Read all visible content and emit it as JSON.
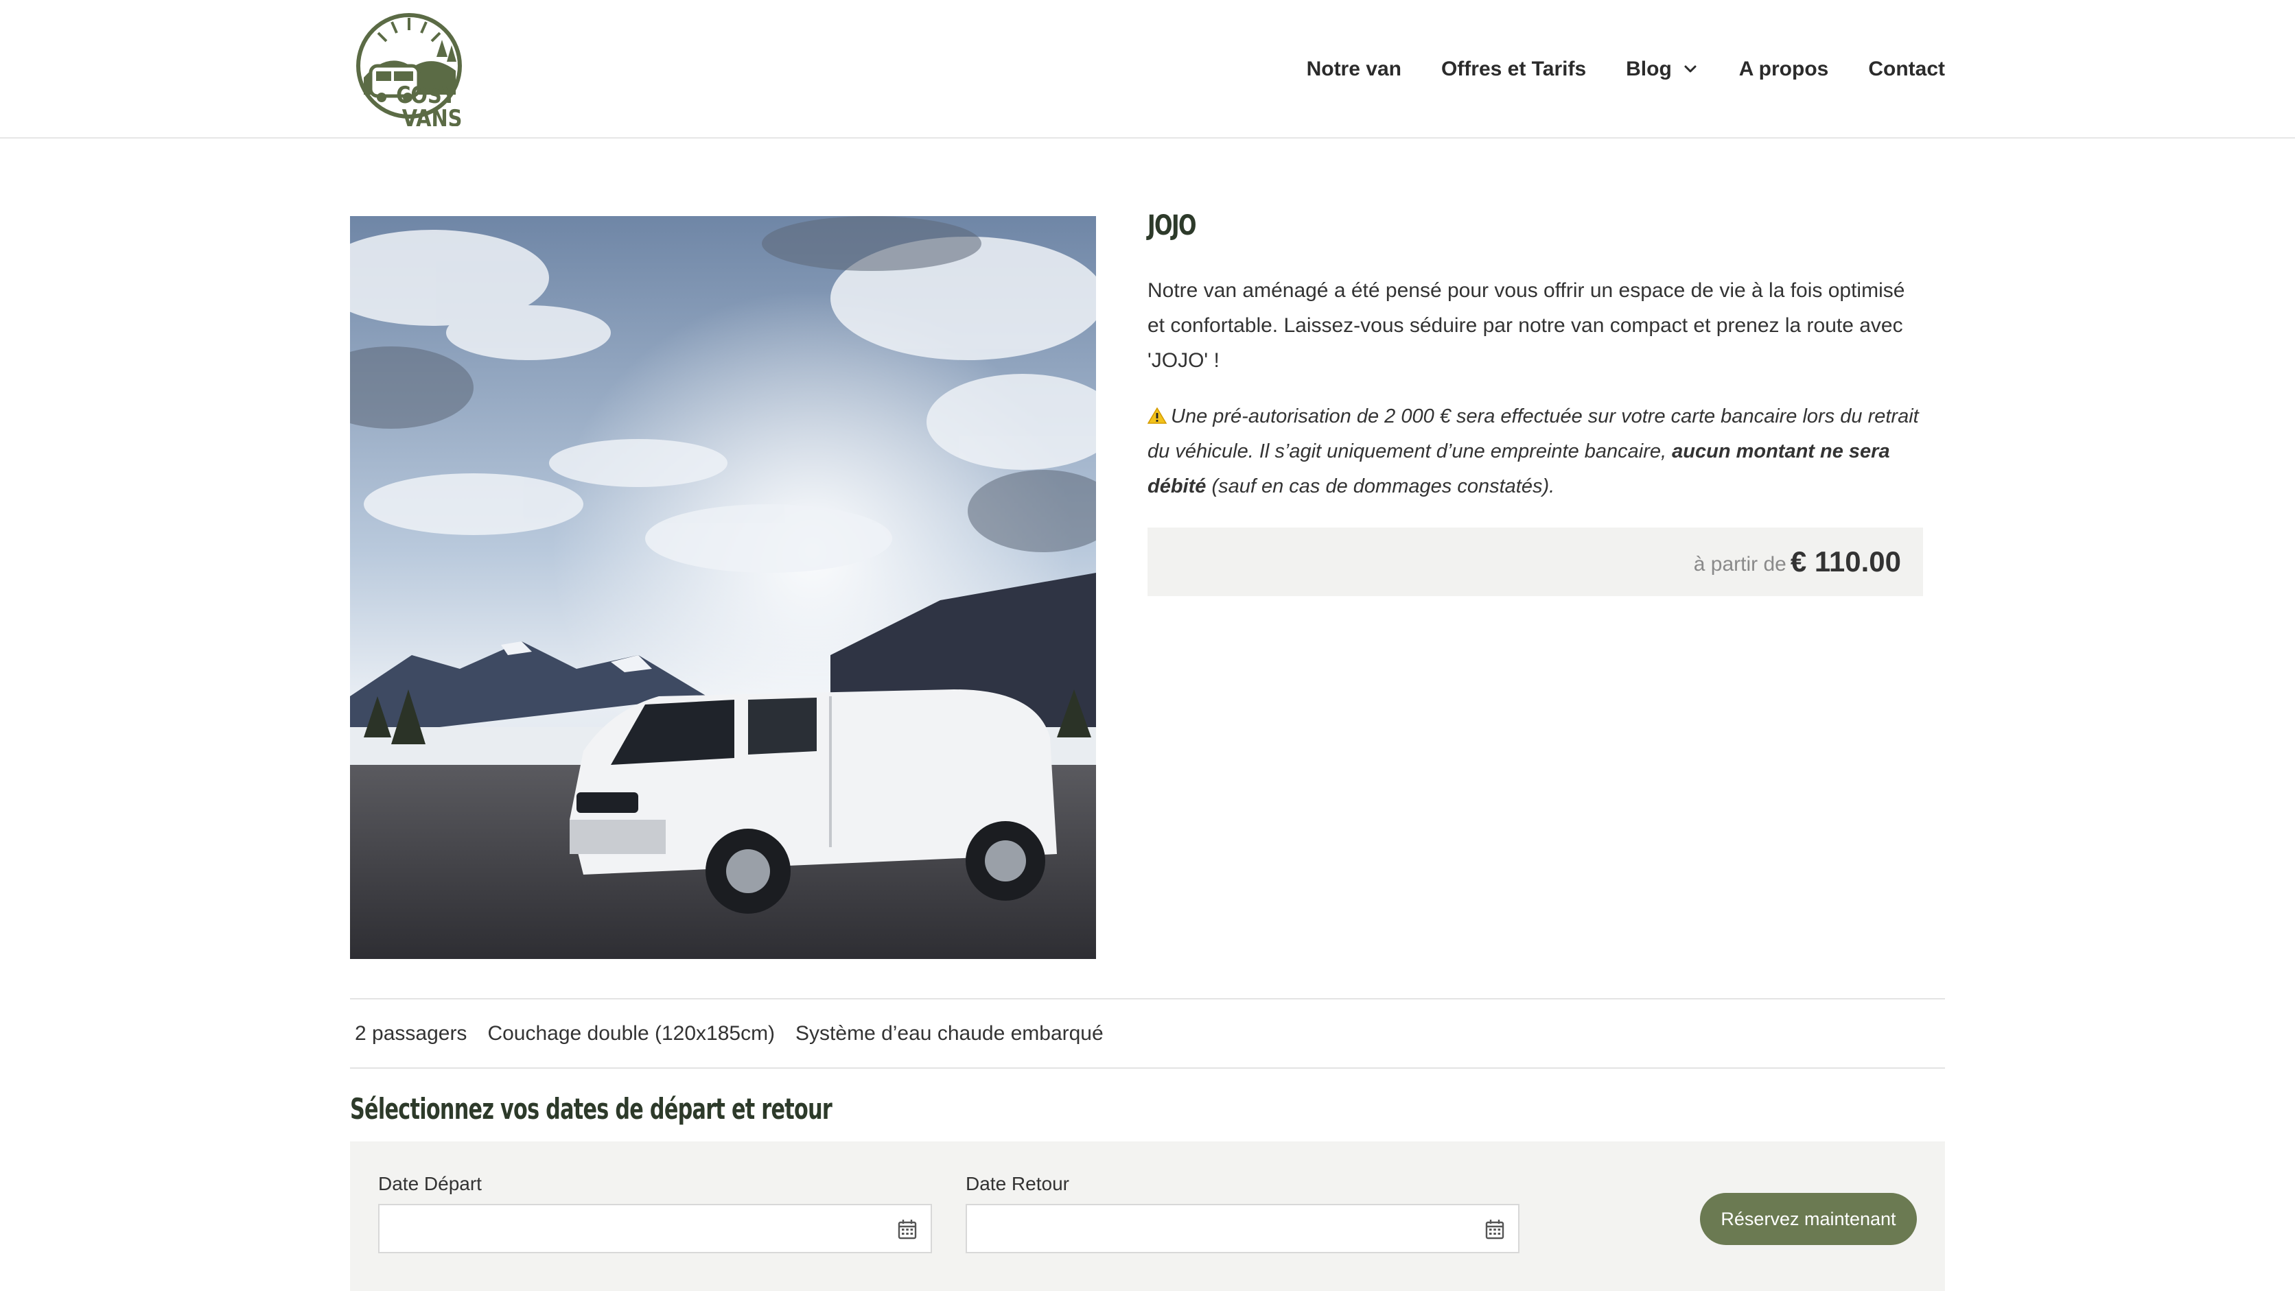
{
  "brand": {
    "logo_text": "COSY VANS",
    "icon": "cosy-vans-logo"
  },
  "nav": {
    "items": [
      {
        "label": "Notre van"
      },
      {
        "label": "Offres et Tarifs"
      },
      {
        "label": "Blog",
        "icon": "chevron-down-icon"
      },
      {
        "label": "A propos"
      },
      {
        "label": "Contact"
      }
    ]
  },
  "product": {
    "title": "JOJO",
    "description": "Notre van aménagé a été pensé pour vous offrir un espace de vie à la fois optimisé et confortable. Laissez-vous séduire par notre van compact et prenez la route avec 'JOJO' !",
    "warning": {
      "icon": "warning-icon",
      "text_before": "Une pré-autorisation de 2 000 € sera effectuée sur votre carte bancaire lors du retrait du véhicule. Il s’agit uniquement d’une empreinte bancaire, ",
      "text_bold": "aucun montant ne sera débité",
      "text_after": " (sauf en cas de dommages constatés)."
    },
    "price_prefix": "à partir de",
    "price": "€ 110.00",
    "features": [
      "2 passagers",
      "Couchage double (120x185cm)",
      "Système d’eau chaude embarqué"
    ]
  },
  "booking": {
    "title": "Sélectionnez vos dates de départ et retour",
    "depart_label": "Date Départ",
    "depart_value": "",
    "retour_label": "Date Retour",
    "retour_value": "",
    "calendar_icon": "calendar-icon",
    "submit_label": "Réservez maintenant"
  },
  "colors": {
    "accent": "#6b7a52",
    "title": "#2d3a2a",
    "price_box": "#f2f2f0",
    "booking_box": "#f3f3f1"
  }
}
